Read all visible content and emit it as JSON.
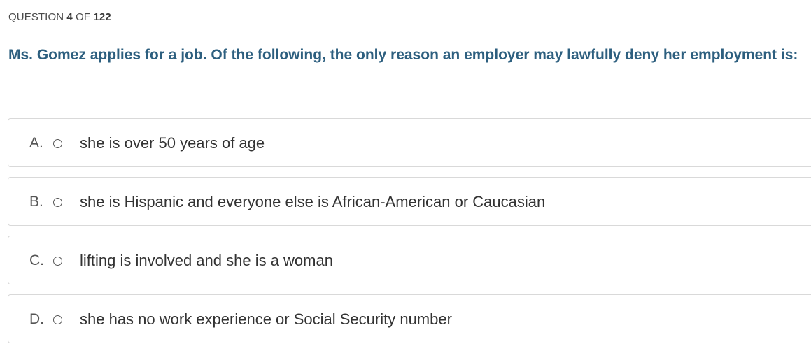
{
  "header": {
    "prefix": "QUESTION",
    "current": "4",
    "of": "OF",
    "total": "122"
  },
  "question": {
    "text": "Ms. Gomez applies for a job. Of the following, the only reason an employer may lawfully deny her employment is:"
  },
  "options": [
    {
      "letter": "A.",
      "text": "she is over 50 years of age"
    },
    {
      "letter": "B.",
      "text": "she is Hispanic and everyone else is African-American or Caucasian"
    },
    {
      "letter": "C.",
      "text": "lifting is involved and she is a woman"
    },
    {
      "letter": "D.",
      "text": "she has no work experience or Social Security number"
    }
  ],
  "colors": {
    "question_text": "#2d5f7f",
    "option_border": "#d9d9d9",
    "header_text": "#4a4a4a"
  }
}
